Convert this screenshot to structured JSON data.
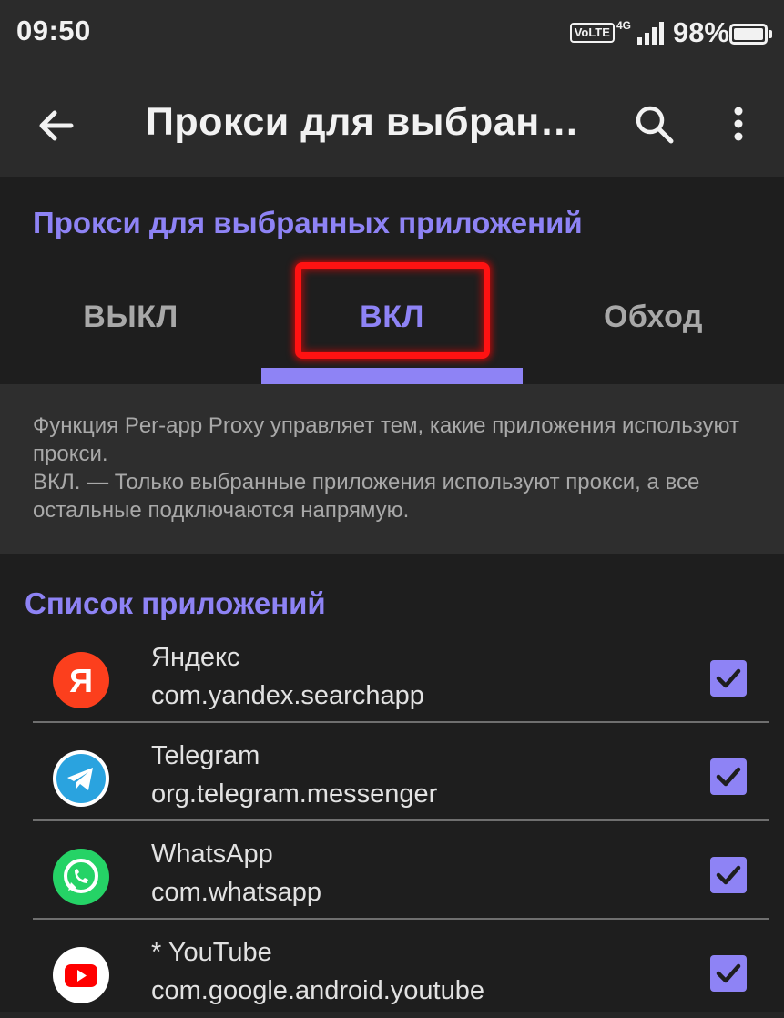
{
  "status_bar": {
    "time": "09:50",
    "volte": "VoLTE",
    "network": "4G",
    "battery_percent": "98%"
  },
  "app_bar": {
    "title": "Прокси для выбранн…",
    "back_icon": "arrow-back-icon",
    "search_icon": "search-icon",
    "menu_icon": "more-vert-icon"
  },
  "proxy_mode": {
    "title": "Прокси для выбранных приложений",
    "tabs": [
      {
        "label": "ВЫКЛ",
        "active": false
      },
      {
        "label": "ВКЛ",
        "active": true
      },
      {
        "label": "Обход",
        "active": false
      }
    ]
  },
  "description": {
    "line1": "Функция Per-app Proxy управляет тем, какие приложения используют прокси.",
    "line2": "ВКЛ. — Только выбранные приложения используют прокси, а все остальные подключаются напрямую."
  },
  "app_list": {
    "title": "Список приложений",
    "items": [
      {
        "name": "Яндекс",
        "package": "com.yandex.searchapp",
        "icon": "yandex-icon",
        "checked": true
      },
      {
        "name": "Telegram",
        "package": "org.telegram.messenger",
        "icon": "telegram-icon",
        "checked": true
      },
      {
        "name": "WhatsApp",
        "package": "com.whatsapp",
        "icon": "whatsapp-icon",
        "checked": true
      },
      {
        "name": "* YouTube",
        "package": "com.google.android.youtube",
        "icon": "youtube-icon",
        "checked": true
      }
    ]
  },
  "colors": {
    "accent": "#8e83f5",
    "highlight": "#ff1212",
    "background": "#1e1e1e"
  }
}
